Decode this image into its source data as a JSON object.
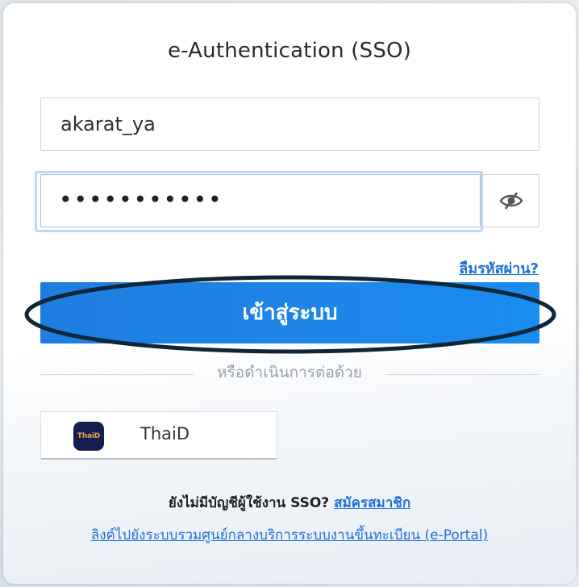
{
  "title": "e-Authentication (SSO)",
  "username": {
    "value": "akarat_ya"
  },
  "password": {
    "masked_value": "•••••••••••"
  },
  "eye_icon": "eye-slash-icon",
  "forgot_password": "ลืมรหัสผ่าน?",
  "login_button": "เข้าสู่ระบบ",
  "divider_text": "หรือดำเนินการต่อด้วย",
  "thaid": {
    "label": "ThaiD",
    "logo_text": "ThaiD"
  },
  "signup": {
    "prompt": "ยังไม่มีบัญชีผู้ใช้งาน SSO?",
    "link": "สมัครสมาชิก"
  },
  "portal_link": "ลิงค์ไปยังระบบรวมศูนย์กลางบริการระบบงานขึ้นทะเบียน (e-Portal)",
  "colors": {
    "primary": "#1e86e8",
    "link": "#1d6fd9",
    "annotation": "#0d2638"
  }
}
